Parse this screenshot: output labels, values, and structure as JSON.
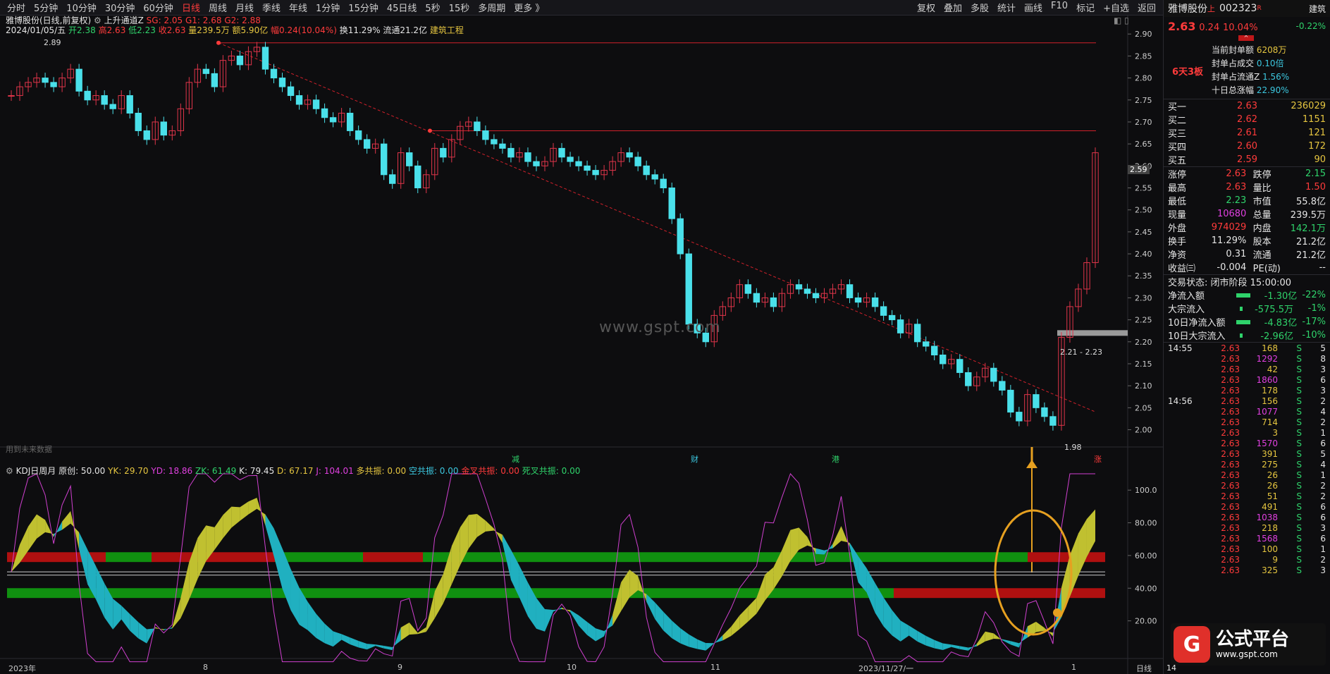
{
  "toolbar": {
    "periods": [
      "分时",
      "5分钟",
      "10分钟",
      "30分钟",
      "60分钟",
      "日线",
      "周线",
      "月线",
      "季线",
      "年线",
      "1分钟",
      "15分钟",
      "45日线",
      "5秒",
      "15秒",
      "多周期",
      "更多 》"
    ],
    "active_period": "日线",
    "right_tools": [
      "复权",
      "叠加",
      "多股",
      "统计",
      "画线",
      "F10",
      "标记",
      "+自选",
      "返回"
    ]
  },
  "header": {
    "stock_title": "雅博股份(日线,前复权)",
    "indicator": "上升通道Z",
    "sg": "SG: 2.05",
    "g1": "G1: 2.68",
    "g2": "G2: 2.88",
    "date": "2024/01/05/五",
    "open": "开2.38",
    "high": "高2.63",
    "low": "低2.23",
    "close": "收2.63",
    "volume": "量239.5万",
    "amount": "额5.90亿",
    "change": "幅0.24(10.04%)",
    "turnover": "换11.29%",
    "float": "流通21.2亿",
    "sector": "建筑工程"
  },
  "labels": {
    "high_mark": "2.89",
    "low_mark": "1.98",
    "range_box": "2.21 - 2.23",
    "watermark": "www.gspt.com",
    "future": "用到未来数据",
    "current_price": "2.59",
    "kdj_title": "KDJ日周月",
    "kdj_base": "原创: 50.00",
    "yk": "YK: 29.70",
    "yd": "YD: 18.86",
    "zk": "ZK: 61.49",
    "k": "K: 79.45",
    "d": "D: 67.17",
    "j": "J: 104.01",
    "duo": "多共振: 0.00",
    "kong": "空共振: 0.00",
    "jincha": "金叉共振: 0.00",
    "sicha": "死叉共振: 0.00",
    "events": [
      "减",
      "财",
      "港",
      "涨"
    ],
    "x_axis": [
      "2023年",
      "8",
      "9",
      "10",
      "11",
      "2023/11/27/一",
      "1",
      "日线"
    ]
  },
  "price_axis": [
    "2.90",
    "2.85",
    "2.80",
    "2.75",
    "2.70",
    "2.65",
    "2.60",
    "2.55",
    "2.50",
    "2.45",
    "2.40",
    "2.35",
    "2.30",
    "2.25",
    "2.20",
    "2.15",
    "2.10",
    "2.05",
    "2.00"
  ],
  "kdj_axis": [
    "100.0",
    "80.00",
    "60.00",
    "40.00",
    "20.00"
  ],
  "candles": [
    2.76,
    2.78,
    2.79,
    2.8,
    2.79,
    2.78,
    2.8,
    2.82,
    2.77,
    2.75,
    2.76,
    2.74,
    2.73,
    2.76,
    2.72,
    2.68,
    2.66,
    2.7,
    2.67,
    2.68,
    2.73,
    2.79,
    2.82,
    2.81,
    2.78,
    2.84,
    2.85,
    2.83,
    2.86,
    2.87,
    2.82,
    2.8,
    2.78,
    2.76,
    2.74,
    2.75,
    2.73,
    2.71,
    2.7,
    2.72,
    2.68,
    2.66,
    2.64,
    2.65,
    2.58,
    2.56,
    2.63,
    2.6,
    2.55,
    2.58,
    2.64,
    2.62,
    2.66,
    2.69,
    2.7,
    2.68,
    2.66,
    2.65,
    2.64,
    2.62,
    2.63,
    2.61,
    2.6,
    2.61,
    2.64,
    2.62,
    2.61,
    2.6,
    2.59,
    2.58,
    2.59,
    2.61,
    2.63,
    2.62,
    2.6,
    2.58,
    2.57,
    2.55,
    2.48,
    2.4,
    2.24,
    2.22,
    2.2,
    2.26,
    2.28,
    2.3,
    2.33,
    2.31,
    2.29,
    2.3,
    2.28,
    2.31,
    2.33,
    2.32,
    2.31,
    2.3,
    2.31,
    2.32,
    2.33,
    2.3,
    2.29,
    2.3,
    2.28,
    2.26,
    2.25,
    2.22,
    2.24,
    2.2,
    2.19,
    2.17,
    2.15,
    2.16,
    2.13,
    2.1,
    2.12,
    2.14,
    2.11,
    2.09,
    2.04,
    2.02,
    2.08,
    2.05,
    2.03,
    2.01,
    2.21,
    2.28,
    2.32,
    2.38,
    2.63
  ],
  "kdj_legend_colors": {
    "k": "#ffffff",
    "d": "#e6c640",
    "j": "#e040e0",
    "yk": "#e6c640",
    "yd": "#e040e0",
    "zk": "#2fd36b",
    "k2": "#ffffff",
    "d2": "#e6c640",
    "j2": "#e040e0",
    "duo": "#e6c640",
    "kong": "#3cc8e0",
    "jincha": "#ff3b3b",
    "sicha": "#2fd36b"
  },
  "panel": {
    "name": "雅博股份",
    "tag": "上",
    "code": "002323",
    "r": "R",
    "sector": "建筑",
    "price": "2.63",
    "chg": "0.24",
    "pct": "10.04%",
    "sector_pct": "-0.22%",
    "board": "6天3板",
    "seal": [
      [
        "当前封单额",
        "6208万"
      ],
      [
        "封单占成交",
        "0.10倍"
      ],
      [
        "封单占流通Z",
        "1.56%"
      ],
      [
        "十日总涨幅",
        "22.90%"
      ]
    ],
    "bids": [
      [
        "买一",
        "2.63",
        "236029"
      ],
      [
        "买二",
        "2.62",
        "1151"
      ],
      [
        "买三",
        "2.61",
        "121"
      ],
      [
        "买四",
        "2.60",
        "172"
      ],
      [
        "买五",
        "2.59",
        "90"
      ]
    ],
    "stats": [
      [
        "涨停",
        "2.63",
        "跌停",
        "2.15"
      ],
      [
        "最高",
        "2.63",
        "量比",
        "1.50"
      ],
      [
        "最低",
        "2.23",
        "市值",
        "55.8亿"
      ],
      [
        "现量",
        "10680",
        "总量",
        "239.5万"
      ],
      [
        "外盘",
        "974029",
        "内盘",
        "142.1万"
      ],
      [
        "换手",
        "11.29%",
        "股本",
        "21.2亿"
      ],
      [
        "净资",
        "0.31",
        "流通",
        "21.2亿"
      ],
      [
        "收益㈢",
        "-0.004",
        "PE(动)",
        "--"
      ]
    ],
    "trade_state": "交易状态: 闭市阶段 15:00:00",
    "flows": [
      [
        "净流入额",
        "-1.30亿",
        "-22%"
      ],
      [
        "大宗流入",
        "-575.5万",
        "-1%"
      ],
      [
        "10日净流入额",
        "-4.83亿",
        "-17%"
      ],
      [
        "10日大宗流入",
        "-2.96亿",
        "-10%"
      ]
    ],
    "ticks_1": {
      "time": "14:55",
      "rows": [
        [
          "2.63",
          "168",
          "S",
          "5"
        ],
        [
          "2.63",
          "1292",
          "S",
          "8"
        ],
        [
          "2.63",
          "42",
          "S",
          "3"
        ],
        [
          "2.63",
          "1860",
          "S",
          "6"
        ],
        [
          "2.63",
          "178",
          "S",
          "3"
        ]
      ]
    },
    "ticks_2": {
      "time": "14:56",
      "rows": [
        [
          "2.63",
          "156",
          "S",
          "2"
        ],
        [
          "2.63",
          "1077",
          "S",
          "4"
        ],
        [
          "2.63",
          "714",
          "S",
          "2"
        ],
        [
          "2.63",
          "3",
          "S",
          "1"
        ],
        [
          "2.63",
          "1570",
          "S",
          "6"
        ],
        [
          "2.63",
          "391",
          "S",
          "5"
        ],
        [
          "2.63",
          "275",
          "S",
          "4"
        ],
        [
          "2.63",
          "26",
          "S",
          "1"
        ],
        [
          "2.63",
          "26",
          "S",
          "2"
        ],
        [
          "2.63",
          "51",
          "S",
          "2"
        ],
        [
          "2.63",
          "491",
          "S",
          "6"
        ],
        [
          "2.63",
          "1038",
          "S",
          "6"
        ],
        [
          "2.63",
          "218",
          "S",
          "3"
        ],
        [
          "2.63",
          "1568",
          "S",
          "6"
        ],
        [
          "2.63",
          "100",
          "S",
          "1"
        ],
        [
          "2.63",
          "9",
          "S",
          "2"
        ],
        [
          "2.63",
          "325",
          "S",
          "3"
        ]
      ]
    },
    "bottom_time": "14",
    "logo_text": "公式平台",
    "logo_url": "www.gspt.com"
  }
}
